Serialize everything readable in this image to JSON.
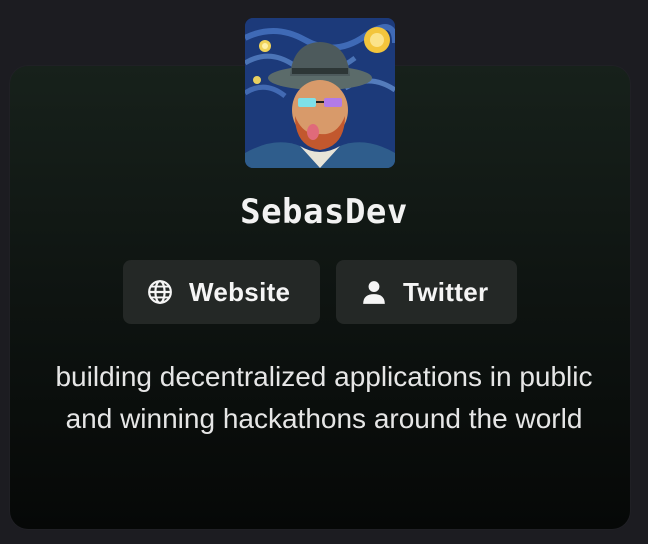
{
  "profile": {
    "name": "SebasDev",
    "bio": "building decentralized applications in public and winning hackathons around the world",
    "avatar_icon": "starry-night-portrait-avatar"
  },
  "links": [
    {
      "label": "Website",
      "icon": "globe-icon"
    },
    {
      "label": "Twitter",
      "icon": "user-icon"
    }
  ],
  "colors": {
    "background": "#1c1c21",
    "card_top": "#17211b",
    "card_bottom": "#060807",
    "button": "#242826",
    "text": "#f2f2f2"
  }
}
